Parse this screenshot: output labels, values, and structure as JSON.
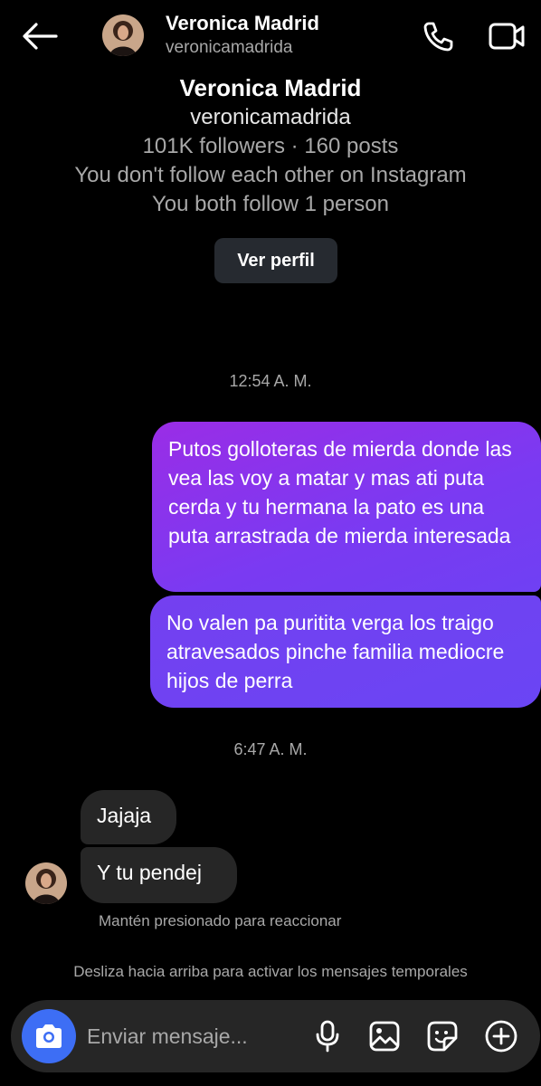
{
  "header": {
    "name": "Veronica Madrid",
    "username": "veronicamadrida",
    "icons": [
      "back-arrow-icon",
      "avatar",
      "phone-icon",
      "video-call-icon"
    ]
  },
  "profile": {
    "name": "Veronica Madrid",
    "username": "veronicamadrida",
    "stats": "101K followers · 160 posts",
    "follow_status": "You don't follow each other on Instagram",
    "mutual": "You both follow 1 person",
    "button_label": "Ver perfil"
  },
  "thread": {
    "time_1": "12:54 A. M.",
    "sent_1": "Putos golloteras de mierda donde las vea las voy a matar y mas ati puta cerda y tu hermana la pato es una puta arrastrada de mierda interesada",
    "sent_2": "No valen pa puritita verga los traigo atravesados pinche familia mediocre hijos de perra",
    "time_2": "6:47 A. M.",
    "recv_1": "Jajaja",
    "recv_2": "Y tu pendej",
    "react_hint": "Mantén presionado para reaccionar",
    "temp_hint": "Desliza hacia arriba para activar los mensajes temporales"
  },
  "composer": {
    "placeholder": "Enviar mensaje...",
    "icons": [
      "camera-icon",
      "microphone-icon",
      "gallery-icon",
      "sticker-icon",
      "plus-icon"
    ]
  },
  "colors": {
    "background": "#000000",
    "sent_gradient_start": "#9a2de6",
    "sent_gradient_end": "#6a45f4",
    "received_bubble": "#262626",
    "camera_button": "#3d6ef5",
    "secondary_text": "#a8a8a8"
  }
}
